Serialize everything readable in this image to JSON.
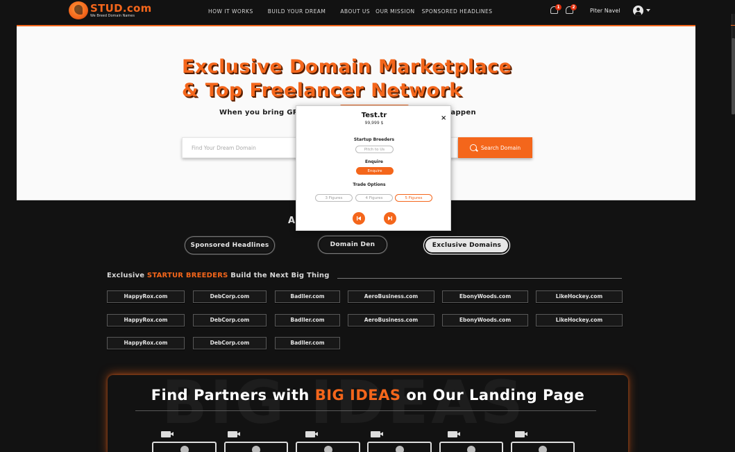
{
  "header": {
    "logo_name": "STUD.com",
    "logo_tagline": "We Breed Domain Names",
    "nav": [
      "HOW IT WORKS",
      "BUILD YOUR DREAM",
      "ABOUT US",
      "OUR MISSION",
      "SPONSORED HEADLINES"
    ],
    "alerts_count": "1",
    "notifications_count": "2",
    "user_name": "Piter Navel"
  },
  "hero": {
    "title_line1": "Exclusive Domain Marketplace",
    "title_line2": "& Top Freelancer Network",
    "subtitle_left": "When you bring GR",
    "subtitle_right": "happen",
    "search_placeholder": "Find Your Dream Domain",
    "search_button": "Search Domain"
  },
  "modal": {
    "domain": "Test.tr",
    "price": "99,999 $",
    "close": "×",
    "startup_label": "Startup Breeders",
    "startup_button": "Pitch to Us",
    "enquire_label": "Enquire",
    "enquire_button": "Enquire",
    "trade_label": "Trade Options",
    "trade_options": [
      "3 Figures",
      "4 Figures",
      "5 Figures"
    ],
    "selected_trade": "5 Figures"
  },
  "tabs": {
    "partial_heading": "A",
    "items": [
      "Sponsored Headlines",
      "Domain Den",
      "Exclusive Domains"
    ],
    "active": "Exclusive Domains"
  },
  "exclusive": {
    "heading_pre": "Exclusive ",
    "heading_highlight": "STARTUR BREEDERS",
    "heading_post": " Build the Next Big Thing",
    "rows": [
      [
        "HappyRox.com",
        "DebCorp.com",
        "Badller.com",
        "AeroBusiness.com",
        "EbonyWoods.com",
        "LikeHockey.com"
      ],
      [
        "HappyRox.com",
        "DebCorp.com",
        "Badller.com",
        "AeroBusiness.com",
        "EbonyWoods.com",
        "LikeHockey.com"
      ],
      [
        "HappyRox.com",
        "DebCorp.com",
        "Badller.com"
      ]
    ]
  },
  "ideas": {
    "background_text": "BIG IDEAS",
    "title_pre": "Find Partners with ",
    "title_highlight": "BIG IDEAS",
    "title_post": " on Our Landing Page",
    "video_count": 6
  },
  "colors": {
    "accent": "#f4661b",
    "background": "#121212",
    "hero_background": "#fafafa"
  }
}
